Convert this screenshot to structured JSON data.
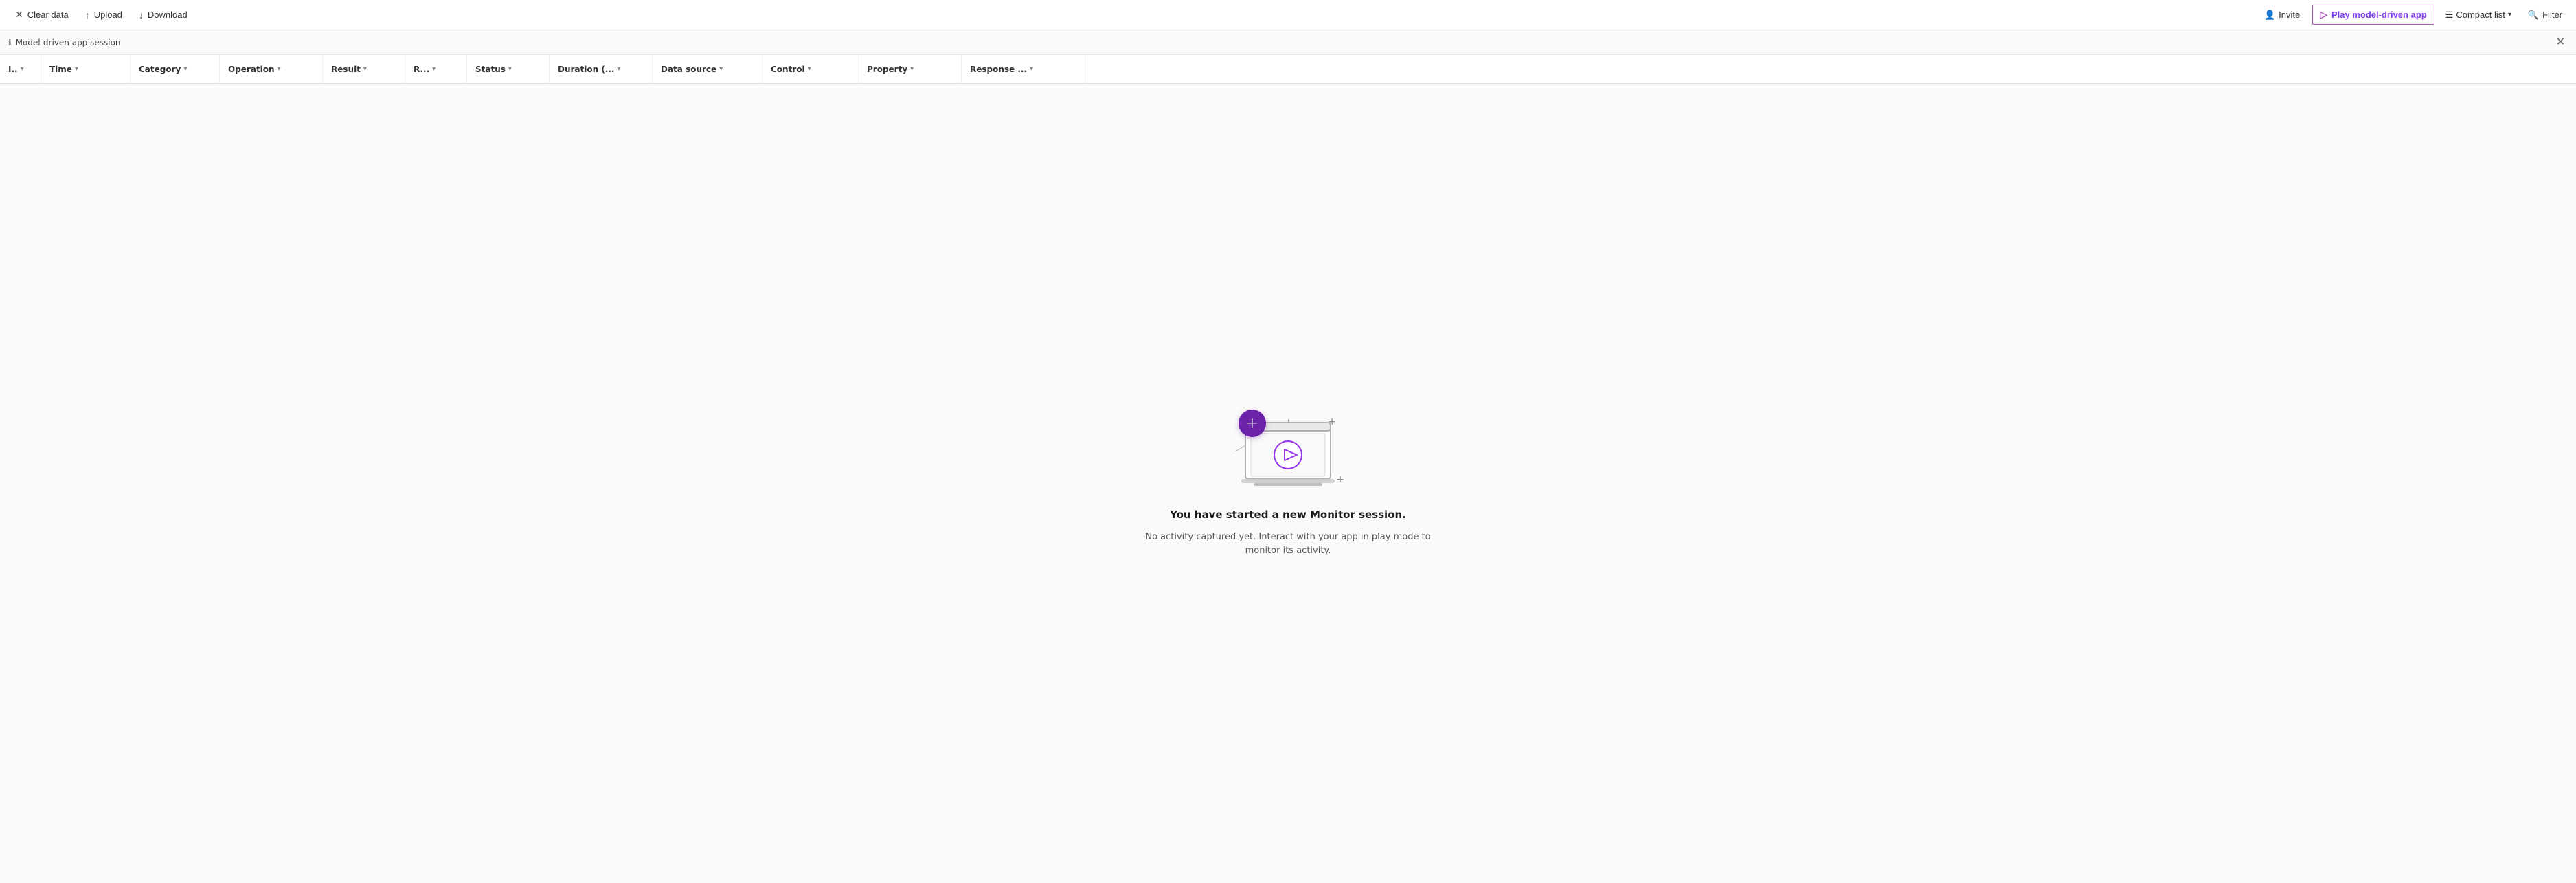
{
  "toolbar": {
    "clear_data_label": "Clear data",
    "upload_label": "Upload",
    "download_label": "Download",
    "invite_label": "Invite",
    "play_model_driven_label": "Play model-driven app",
    "compact_list_label": "Compact list",
    "filter_label": "Filter"
  },
  "session": {
    "label": "Model-driven app session"
  },
  "columns": [
    {
      "id": "id",
      "label": "I..",
      "width": 60
    },
    {
      "id": "time",
      "label": "Time",
      "width": 130
    },
    {
      "id": "category",
      "label": "Category",
      "width": 130
    },
    {
      "id": "operation",
      "label": "Operation",
      "width": 150
    },
    {
      "id": "result",
      "label": "Result",
      "width": 120
    },
    {
      "id": "r",
      "label": "R...",
      "width": 90
    },
    {
      "id": "status",
      "label": "Status",
      "width": 120
    },
    {
      "id": "duration",
      "label": "Duration (...",
      "width": 150
    },
    {
      "id": "datasource",
      "label": "Data source",
      "width": 160
    },
    {
      "id": "control",
      "label": "Control",
      "width": 140
    },
    {
      "id": "property",
      "label": "Property",
      "width": 150
    },
    {
      "id": "response",
      "label": "Response ...",
      "width": 180
    }
  ],
  "empty_state": {
    "title": "You have started a new Monitor session.",
    "description": "No activity captured yet. Interact with your app in play mode to monitor its activity."
  },
  "colors": {
    "accent_purple": "#6b21a8",
    "play_btn_border": "#a855b5",
    "play_btn_text": "#7c3aed"
  }
}
